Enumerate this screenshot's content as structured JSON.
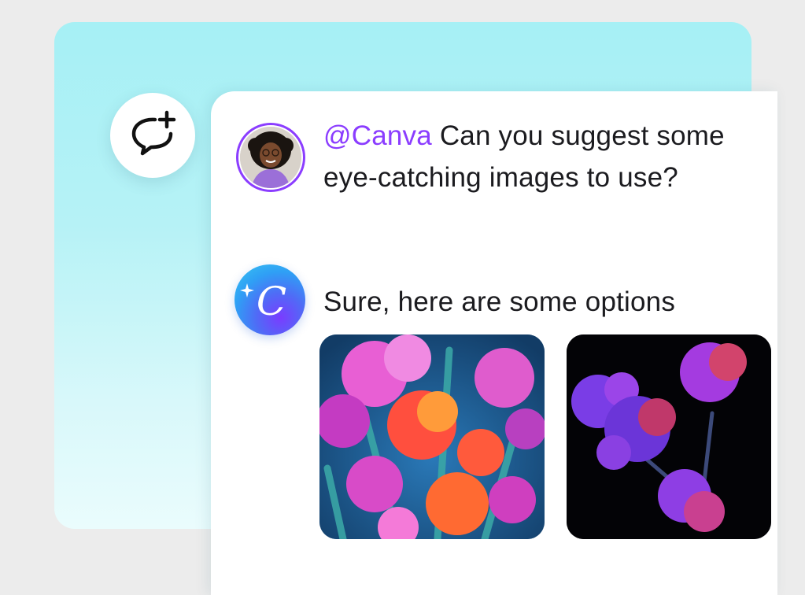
{
  "conversation": {
    "new_chat_icon": "chat-plus-icon",
    "user_message": {
      "mention": "@Canva",
      "text": " Can you suggest some eye-catching images to use?"
    },
    "assistant_message": {
      "text": "Sure, here are some options"
    },
    "image_options": [
      {
        "subject": "pink and blue carnations"
      },
      {
        "subject": "purple carnations on black"
      }
    ]
  },
  "colors": {
    "mention": "#8b3dff",
    "background_top": "#a6f0f5",
    "background_bottom": "#eafcfd"
  }
}
